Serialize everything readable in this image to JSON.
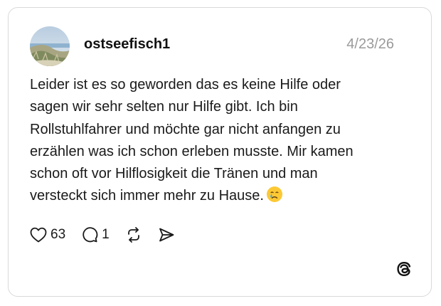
{
  "post": {
    "username": "ostseefisch1",
    "date": "4/23/26",
    "text_lines": [
      "Leider ist es so geworden das es keine Hilfe oder",
      "sagen wir sehr selten nur Hilfe gibt. Ich bin",
      "Rollstuhlfahrer und möchte gar nicht anfangen zu",
      "erzählen was ich schon erleben musste. Mir kamen",
      "schon oft vor Hilflosigkeit die Tränen  und man",
      "versteckt sich immer mehr zu Hause."
    ],
    "emoji": "crying-face"
  },
  "actions": {
    "likes": "63",
    "replies": "1"
  },
  "icons": {
    "like": "heart-icon",
    "reply": "comment-icon",
    "repost": "repost-icon",
    "share": "send-icon",
    "brand": "threads-logo-icon"
  },
  "colors": {
    "text": "#1a1a1a",
    "muted": "#9a9a9a",
    "border": "#d9d9d9"
  }
}
